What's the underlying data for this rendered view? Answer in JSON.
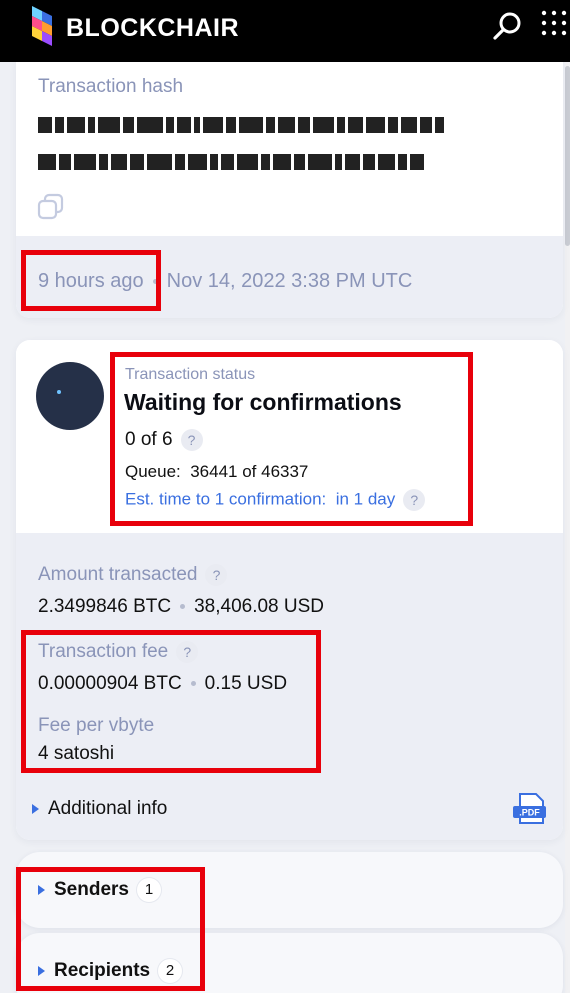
{
  "header": {
    "brand": "BLOCKCHAIR",
    "icons": {
      "search": "search-icon",
      "menu": "grid-menu-icon"
    }
  },
  "transaction": {
    "hash_label": "Transaction hash",
    "relative_time": "9 hours ago",
    "timestamp": "Nov 14, 2022 3:38 PM UTC"
  },
  "status": {
    "title": "Transaction status",
    "main": "Waiting for confirmations",
    "confirmations": "0 of 6",
    "queue_label": "Queue:",
    "queue_value": "36441 of 46337",
    "est_label": "Est. time to 1 confirmation:",
    "est_value": "in 1 day",
    "help_glyph": "?"
  },
  "details": {
    "amount_label": "Amount transacted",
    "amount_btc": "2.3499846 BTC",
    "amount_usd": "38,406.08 USD",
    "fee_label": "Transaction fee",
    "fee_btc": "0.00000904 BTC",
    "fee_usd": "0.15 USD",
    "fee_per_vbyte_label": "Fee per vbyte",
    "fee_per_vbyte": "4 satoshi",
    "additional_info": "Additional info",
    "pdf_label": ".PDF"
  },
  "sections": [
    {
      "label": "Senders",
      "count": "1"
    },
    {
      "label": "Recipients",
      "count": "2"
    }
  ],
  "colors": {
    "accent_blue": "#3a6fe0",
    "highlight_red": "#e8000b",
    "topbar_black": "#000000",
    "page_bg": "#eef0f5"
  }
}
